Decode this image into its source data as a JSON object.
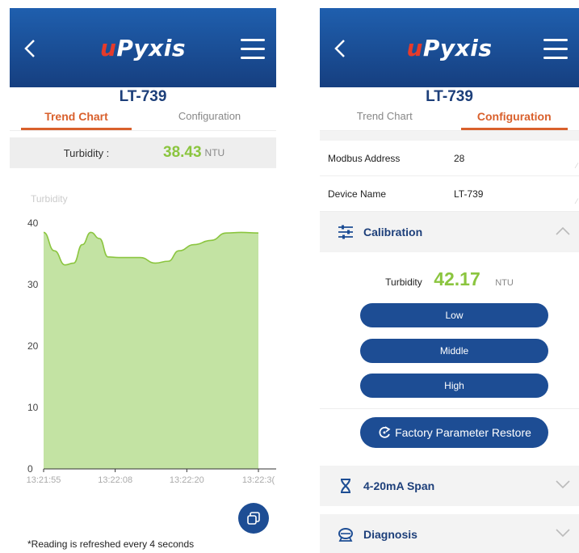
{
  "logo": {
    "prefix": "u",
    "rest": "Pyxis"
  },
  "device_title": "LT-739",
  "tabs": {
    "trend": "Trend Chart",
    "config": "Configuration"
  },
  "left": {
    "reading_label": "Turbidity :",
    "reading_value": "38.43",
    "reading_unit": "NTU",
    "footnote": "*Reading is refreshed every 4 seconds"
  },
  "chart_data": {
    "type": "area",
    "legend": "Turbidity",
    "x_ticks": [
      "13:21:55",
      "13:22:08",
      "13:22:20",
      "13:22:3("
    ],
    "y_ticks": [
      0,
      10,
      20,
      30,
      40
    ],
    "ylim": [
      0,
      40
    ],
    "grid": false,
    "points": [
      [
        0,
        38.5
      ],
      [
        0.05,
        35.5
      ],
      [
        0.1,
        33.2
      ],
      [
        0.14,
        33.5
      ],
      [
        0.18,
        36.5
      ],
      [
        0.22,
        38.5
      ],
      [
        0.26,
        37.5
      ],
      [
        0.3,
        34.5
      ],
      [
        0.35,
        34.4
      ],
      [
        0.45,
        34.4
      ],
      [
        0.52,
        33.5
      ],
      [
        0.58,
        33.8
      ],
      [
        0.63,
        35.5
      ],
      [
        0.7,
        36.5
      ],
      [
        0.78,
        37.2
      ],
      [
        0.85,
        38.4
      ],
      [
        0.92,
        38.5
      ],
      [
        1.0,
        38.4
      ]
    ],
    "fill_color": "#c3e3a3",
    "line_color": "#8bc53f"
  },
  "right": {
    "fields": [
      {
        "name": "Modbus Address",
        "value": "28"
      },
      {
        "name": "Device Name",
        "value": "LT-739"
      }
    ],
    "calibration": {
      "title": "Calibration",
      "label": "Turbidity",
      "value": "42.17",
      "unit": "NTU",
      "buttons": [
        "Low",
        "Middle",
        "High"
      ]
    },
    "restore_label": "Factory Parameter Restore",
    "sections": [
      "4-20mA Span",
      "Diagnosis"
    ]
  },
  "colors": {
    "brand": "#1d4d94",
    "accent": "#d9602c",
    "value": "#8bc53f"
  }
}
